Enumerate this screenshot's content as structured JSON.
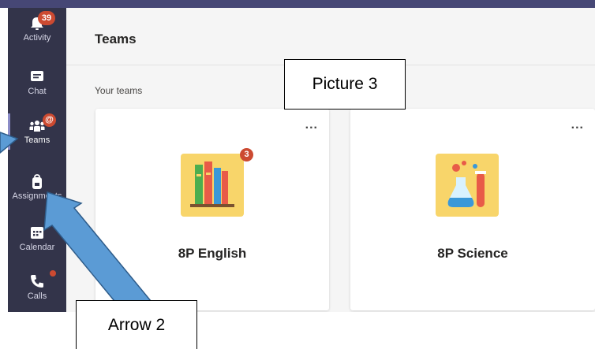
{
  "rail": {
    "items": [
      {
        "label": "Activity",
        "badge": "39"
      },
      {
        "label": "Chat"
      },
      {
        "label": "Teams",
        "badge": "@"
      },
      {
        "label": "Assignments"
      },
      {
        "label": "Calendar"
      },
      {
        "label": "Calls"
      }
    ]
  },
  "header": {
    "title": "Teams"
  },
  "section": {
    "label": "Your teams"
  },
  "teams": [
    {
      "name": "8P English",
      "more": "...",
      "badge": "3"
    },
    {
      "name": "8P Science",
      "more": "..."
    }
  ],
  "callouts": {
    "picture": "Picture 3",
    "arrow": "Arrow 2"
  },
  "colors": {
    "rail": "#33344a",
    "topstrip": "#464775",
    "badge": "#cc4a31",
    "tile": "#f8d56a",
    "arrow": "#5b9bd5"
  }
}
